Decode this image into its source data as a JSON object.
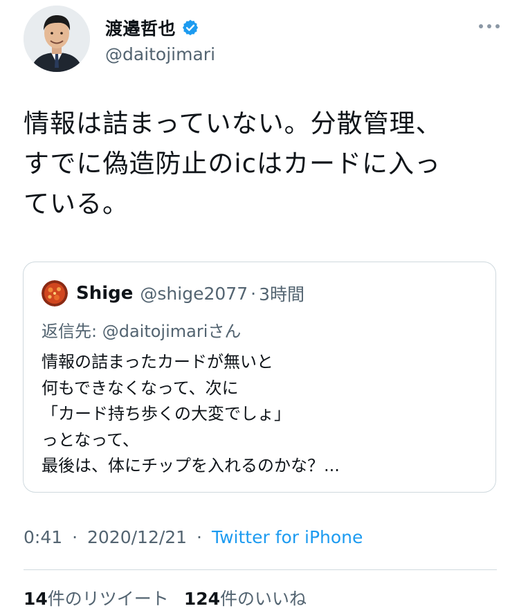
{
  "author": {
    "display_name": "渡邉哲也",
    "handle": "@daitojimari",
    "verified": true,
    "avatar_icon": "person-avatar"
  },
  "more_icon": "ellipsis-icon",
  "tweet": {
    "lines": [
      "情報は詰まっていない。分散管理、",
      "すでに偽造防止のicはカードに入っ",
      "ている。"
    ]
  },
  "quote": {
    "display_name": "Shige",
    "handle": "@shige2077",
    "separator": "·",
    "time": "3時間",
    "reply_prefix": "返信先: ",
    "reply_mention": "@daitojimari",
    "reply_suffix": "さん",
    "lines": [
      "情報の詰まったカードが無いと",
      "何もできなくなって、次に",
      "「カード持ち歩くの大変でしょ」",
      "っとなって、",
      "最後は、体にチップを入れるのかな？..."
    ]
  },
  "meta": {
    "time": "0:41",
    "sep1": "·",
    "date": "2020/12/21",
    "sep2": "·",
    "client": "Twitter for iPhone"
  },
  "stats": {
    "retweets_count": "14",
    "retweets_label": "件のリツイート",
    "likes_count": "124",
    "likes_label": "件のいいね"
  },
  "colors": {
    "text": "#0f1419",
    "secondary": "#536471",
    "link": "#1d9bf0",
    "border": "#cfd9de"
  }
}
